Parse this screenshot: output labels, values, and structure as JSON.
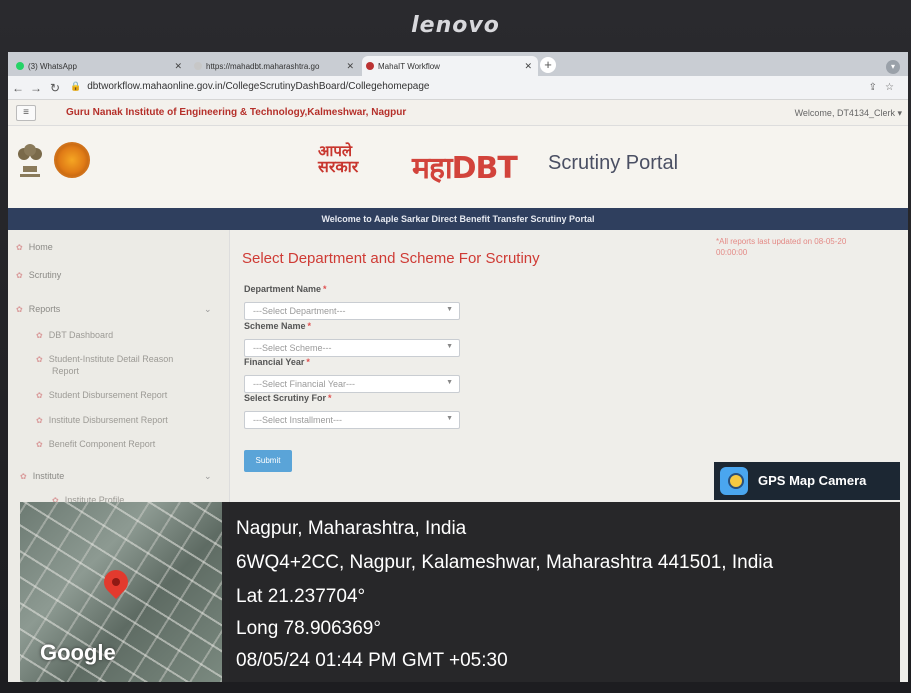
{
  "bezel": {
    "brand": "lenovo"
  },
  "browser": {
    "tabs": [
      {
        "label": "(3) WhatsApp"
      },
      {
        "label": "https://mahadbt.maharashtra.go"
      },
      {
        "label": "MahaIT Workflow"
      }
    ],
    "url": "dbtworkflow.mahaonline.gov.in/CollegeScrutinyDashBoard/Collegehomepage"
  },
  "header": {
    "institute": "Guru Nanak Institute of Engineering & Technology,Kalmeshwar, Nagpur",
    "welcome": "Welcome, DT4134_Clerk",
    "logo_aaple_line1": "आपले",
    "logo_aaple_line2": "सरकार",
    "logo_maha": "महाDBT",
    "portal": "Scrutiny Portal",
    "banner": "Welcome to Aaple Sarkar Direct Benefit Transfer Scrutiny Portal"
  },
  "sidebar": {
    "items": [
      {
        "label": "Home"
      },
      {
        "label": "Scrutiny"
      },
      {
        "label": "Reports"
      },
      {
        "label": "DBT Dashboard"
      },
      {
        "label": "Student-Institute Detail Reason"
      },
      {
        "label": "Report"
      },
      {
        "label": "Student Disbursement Report"
      },
      {
        "label": "Institute Disbursement Report"
      },
      {
        "label": "Benefit Component Report"
      },
      {
        "label": "Institute"
      },
      {
        "label": "Institute Profile"
      }
    ]
  },
  "main": {
    "title": "Select Department and Scheme For Scrutiny",
    "notice_line1": "*All reports last updated on 08-05-20",
    "notice_line2": "00:00:00",
    "fields": [
      {
        "label": "Department Name",
        "value": "---Select Department---"
      },
      {
        "label": "Scheme Name",
        "value": "---Select Scheme---"
      },
      {
        "label": "Financial Year",
        "value": "---Select Financial Year---"
      },
      {
        "label": "Select Scrutiny For",
        "value": "---Select Installment---"
      }
    ],
    "submit": "Submit"
  },
  "gps": {
    "badge": "GPS Map Camera",
    "place": "Nagpur, Maharashtra, India",
    "address": "6WQ4+2CC, Nagpur, Kalameshwar, Maharashtra 441501, India",
    "lat": "Lat 21.237704°",
    "long": "Long 78.906369°",
    "datetime": "08/05/24 01:44 PM GMT +05:30",
    "map_brand": "Google"
  }
}
